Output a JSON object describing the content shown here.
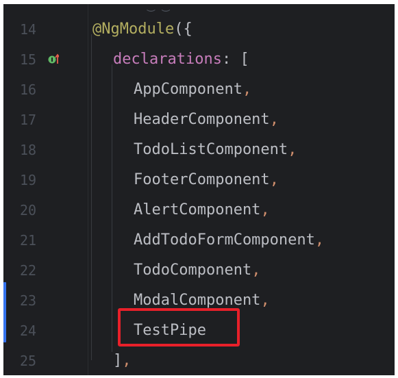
{
  "editor": {
    "lines": [
      {
        "number": "14",
        "parts": [
          {
            "t": "@NgModule",
            "c": "ann"
          },
          {
            "t": "({",
            "c": "ann-punct"
          }
        ],
        "indent": 0
      },
      {
        "number": "15",
        "parts": [
          {
            "t": "declarations",
            "c": "prop"
          },
          {
            "t": ": [",
            "c": "punct"
          }
        ],
        "indent": 1
      },
      {
        "number": "16",
        "parts": [
          {
            "t": "AppComponent",
            "c": "ident"
          },
          {
            "t": ",",
            "c": "comma"
          }
        ],
        "indent": 2
      },
      {
        "number": "17",
        "parts": [
          {
            "t": "HeaderComponent",
            "c": "ident"
          },
          {
            "t": ",",
            "c": "comma"
          }
        ],
        "indent": 2
      },
      {
        "number": "18",
        "parts": [
          {
            "t": "TodoListComponent",
            "c": "ident"
          },
          {
            "t": ",",
            "c": "comma"
          }
        ],
        "indent": 2
      },
      {
        "number": "19",
        "parts": [
          {
            "t": "FooterComponent",
            "c": "ident"
          },
          {
            "t": ",",
            "c": "comma"
          }
        ],
        "indent": 2
      },
      {
        "number": "20",
        "parts": [
          {
            "t": "AlertComponent",
            "c": "ident"
          },
          {
            "t": ",",
            "c": "comma"
          }
        ],
        "indent": 2
      },
      {
        "number": "21",
        "parts": [
          {
            "t": "AddTodoFormComponent",
            "c": "ident"
          },
          {
            "t": ",",
            "c": "comma"
          }
        ],
        "indent": 2
      },
      {
        "number": "22",
        "parts": [
          {
            "t": "TodoComponent",
            "c": "ident"
          },
          {
            "t": ",",
            "c": "comma"
          }
        ],
        "indent": 2
      },
      {
        "number": "23",
        "parts": [
          {
            "t": "ModalComponent",
            "c": "ident"
          },
          {
            "t": ",",
            "c": "comma"
          }
        ],
        "indent": 2
      },
      {
        "number": "24",
        "parts": [
          {
            "t": "TestPipe",
            "c": "ident"
          }
        ],
        "indent": 2
      },
      {
        "number": "25",
        "parts": [
          {
            "t": "]",
            "c": "punct"
          },
          {
            "t": ",",
            "c": "comma"
          }
        ],
        "indent": 1
      }
    ],
    "highlighted_line": "24",
    "gutter_icon": "implements-indicator-icon",
    "colors": {
      "background": "#1e1f22",
      "annotation": "#b3ae60",
      "property": "#c77dbb",
      "identifier": "#bcbec4",
      "comma": "#cf8e6d",
      "line_number": "#4b5059",
      "highlight_border": "#e8202a",
      "vcs_modified": "#3574f0"
    }
  }
}
